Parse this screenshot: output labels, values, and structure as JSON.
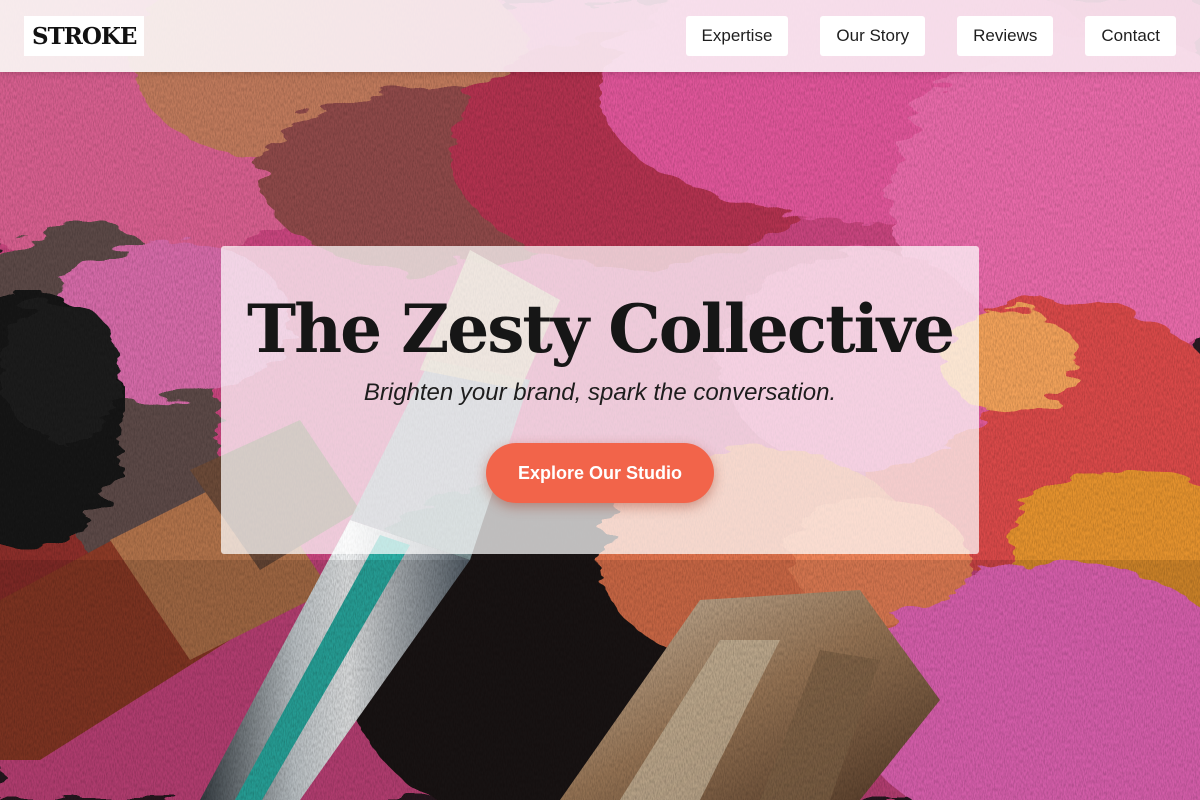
{
  "header": {
    "logo_text": "STROKE",
    "nav": [
      {
        "label": "Expertise"
      },
      {
        "label": "Our Story"
      },
      {
        "label": "Reviews"
      },
      {
        "label": "Contact"
      }
    ]
  },
  "hero": {
    "title": "The Zesty Collective",
    "tagline": "Brighten your brand, spark the conversation.",
    "cta_label": "Explore Our Studio",
    "background_image": "paint-brushes-and-pink-paint-photo"
  },
  "colors": {
    "cta_background": "#f2644a",
    "cta_text": "#ffffff",
    "nav_background": "#ffffff",
    "title_text": "#161616"
  }
}
